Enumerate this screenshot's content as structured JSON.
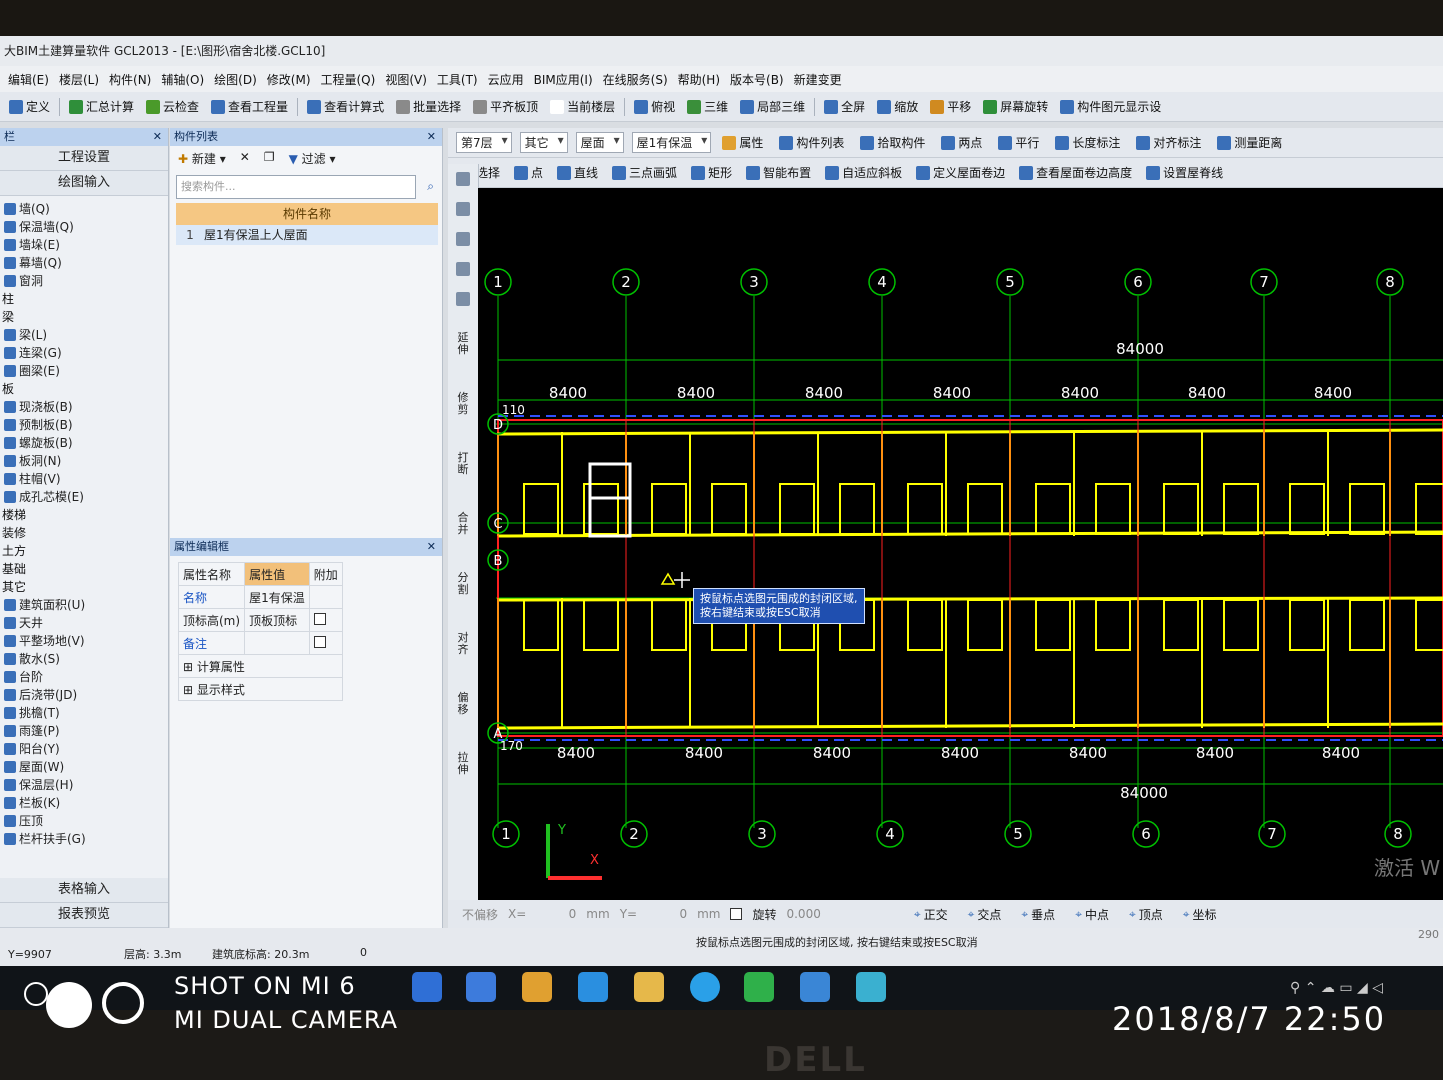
{
  "window": {
    "title": "大BIM土建算量软件 GCL2013 - [E:\\图形\\宿舍北楼.GCL10]"
  },
  "menu": [
    "编辑(E)",
    "楼层(L)",
    "构件(N)",
    "辅轴(O)",
    "绘图(D)",
    "修改(M)",
    "工程量(Q)",
    "视图(V)",
    "工具(T)",
    "云应用",
    "BIM应用(I)",
    "在线服务(S)",
    "帮助(H)",
    "版本号(B)",
    "新建变更"
  ],
  "toolbar1": {
    "items": [
      "定义",
      "汇总计算",
      "云检查",
      "查看工程量",
      "查看计算式",
      "批量选择",
      "平齐板顶",
      "当前楼层",
      "俯视",
      "三维",
      "局部三维",
      "全屏",
      "缩放",
      "平移",
      "屏幕旋转",
      "构件图元显示设"
    ]
  },
  "left_nav": {
    "header": "栏",
    "top_buttons": [
      "工程设置",
      "绘图输入"
    ],
    "tree": [
      {
        "label": "墙(Q)",
        "type": "item"
      },
      {
        "label": "保温墙(Q)",
        "type": "item"
      },
      {
        "label": "墙垛(E)",
        "type": "item"
      },
      {
        "label": "幕墙(Q)",
        "type": "item"
      },
      {
        "label": "窗洞",
        "type": "item"
      },
      {
        "label": "柱",
        "type": "cat"
      },
      {
        "label": "梁",
        "type": "cat"
      },
      {
        "label": "梁(L)",
        "type": "item"
      },
      {
        "label": "连梁(G)",
        "type": "item"
      },
      {
        "label": "圈梁(E)",
        "type": "item"
      },
      {
        "label": "板",
        "type": "cat"
      },
      {
        "label": "现浇板(B)",
        "type": "item"
      },
      {
        "label": "预制板(B)",
        "type": "item"
      },
      {
        "label": "螺旋板(B)",
        "type": "item"
      },
      {
        "label": "板洞(N)",
        "type": "item"
      },
      {
        "label": "柱帽(V)",
        "type": "item"
      },
      {
        "label": "成孔芯模(E)",
        "type": "item"
      },
      {
        "label": "楼梯",
        "type": "cat"
      },
      {
        "label": "装修",
        "type": "cat"
      },
      {
        "label": "土方",
        "type": "cat"
      },
      {
        "label": "基础",
        "type": "cat"
      },
      {
        "label": "其它",
        "type": "cat"
      },
      {
        "label": "建筑面积(U)",
        "type": "item"
      },
      {
        "label": "天井",
        "type": "item"
      },
      {
        "label": "平整场地(V)",
        "type": "item"
      },
      {
        "label": "散水(S)",
        "type": "item"
      },
      {
        "label": "台阶",
        "type": "item"
      },
      {
        "label": "后浇带(JD)",
        "type": "item"
      },
      {
        "label": "挑檐(T)",
        "type": "item"
      },
      {
        "label": "雨篷(P)",
        "type": "item"
      },
      {
        "label": "阳台(Y)",
        "type": "item"
      },
      {
        "label": "屋面(W)",
        "type": "item"
      },
      {
        "label": "保温层(H)",
        "type": "item"
      },
      {
        "label": "栏板(K)",
        "type": "item"
      },
      {
        "label": "压顶",
        "type": "item"
      },
      {
        "label": "栏杆扶手(G)",
        "type": "item"
      }
    ],
    "bottom_buttons": [
      "表格输入",
      "报表预览"
    ]
  },
  "component_list": {
    "title": "构件列表",
    "new_label": "新建",
    "filter_label": "过滤",
    "search_placeholder": "搜索构件...",
    "column_header": "构件名称",
    "rows": [
      {
        "num": "1",
        "name": "屋1有保温上人屋面"
      }
    ]
  },
  "property_editor": {
    "title": "属性编辑框",
    "headers": [
      "属性名称",
      "属性值",
      "附加"
    ],
    "rows": [
      {
        "name": "名称",
        "value": "屋1有保温",
        "blue": true,
        "check": false
      },
      {
        "name": "顶标高(m)",
        "value": "顶板顶标",
        "blue": false,
        "check": true
      },
      {
        "name": "备注",
        "value": "",
        "blue": true,
        "check": true
      }
    ],
    "groups": [
      "计算属性",
      "显示样式"
    ]
  },
  "drawing_toolbar_a": {
    "floor": "第7层",
    "type": "其它",
    "category": "屋面",
    "component": "屋1有保温",
    "items": [
      "属性",
      "构件列表",
      "拾取构件",
      "两点",
      "平行",
      "长度标注",
      "对齐标注",
      "测量距离"
    ]
  },
  "drawing_toolbar_b": {
    "items": [
      "选择",
      "点",
      "直线",
      "三点画弧",
      "矩形",
      "智能布置",
      "自适应斜板",
      "定义屋面卷边",
      "查看屋面卷边高度",
      "设置屋脊线"
    ]
  },
  "side_tools": [
    "延伸",
    "修剪",
    "打断",
    "合并",
    "分割",
    "对齐",
    "偏移",
    "拉伸"
  ],
  "canvas": {
    "axis_top": [
      "1",
      "2",
      "3",
      "4",
      "5",
      "6",
      "7",
      "8"
    ],
    "axis_bottom": [
      "1",
      "2",
      "3",
      "4",
      "5",
      "6",
      "7",
      "8"
    ],
    "axis_left": [
      "D",
      "C",
      "B",
      "A"
    ],
    "dim_top_total": "84000",
    "dim_bottom_total": "84000",
    "dim_span": "8400",
    "dim_small_left_top": "110",
    "dim_small_left_bottom": "170",
    "tooltip_line1": "按鼠标点选图元围成的封闭区域,",
    "tooltip_line2": "按右键结束或按ESC取消",
    "axis_y": "Y",
    "axis_x": "X",
    "activate_text": "激活 W",
    "colors": {
      "grid": "#00c000",
      "beam": "#ffff00",
      "red": "#ff2020",
      "bg": "#000000"
    }
  },
  "status_a": {
    "no_offset": "不偏移",
    "x_label": "X=",
    "x_value": "0",
    "unit1": "mm",
    "y_label": "Y=",
    "y_value": "0",
    "unit2": "mm",
    "rotate": "旋转",
    "rotate_value": "0.000",
    "snaps": [
      "正交",
      "交点",
      "垂点",
      "中点",
      "顶点",
      "坐标"
    ]
  },
  "status_b": {
    "coord": "Y=9907",
    "floor_height": "层高: 3.3m",
    "base_elev": "建筑底标高: 20.3m",
    "zero": "0",
    "hint": "按鼠标点选图元围成的封闭区域, 按右键结束或按ESC取消",
    "right": "290"
  },
  "photo": {
    "watermark1": "SHOT ON MI 6",
    "watermark2": "MI DUAL CAMERA",
    "date": "2018/8/7  22:50",
    "brand": "DELL"
  }
}
